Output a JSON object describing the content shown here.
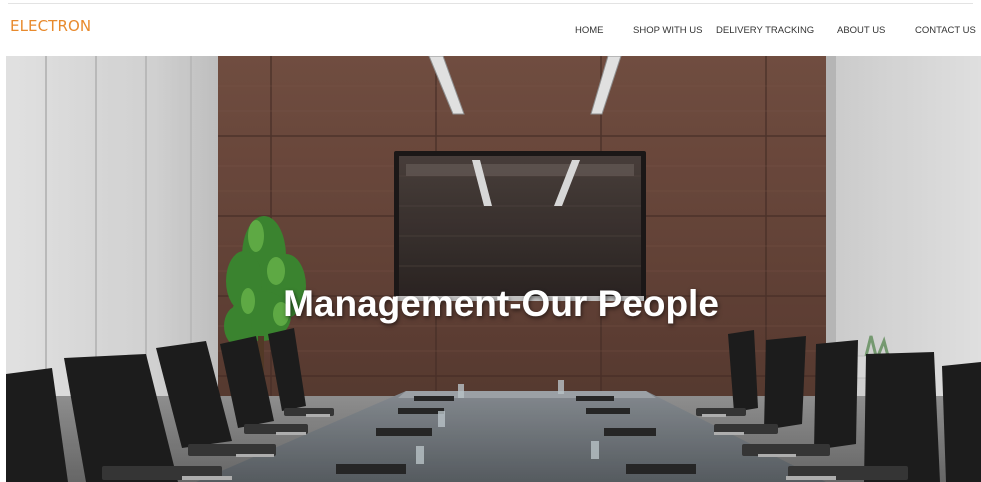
{
  "brand": {
    "logo_text": "ELECTRON",
    "accent_color": "#e88a2d"
  },
  "nav": {
    "items": [
      {
        "label": "HOME"
      },
      {
        "label": "SHOP WITH US"
      },
      {
        "label": "DELIVERY TRACKING"
      },
      {
        "label": "ABOUT US"
      },
      {
        "label": "CONTACT US"
      }
    ]
  },
  "hero": {
    "title": "Management-Our People",
    "image": "conference-room-photo"
  }
}
